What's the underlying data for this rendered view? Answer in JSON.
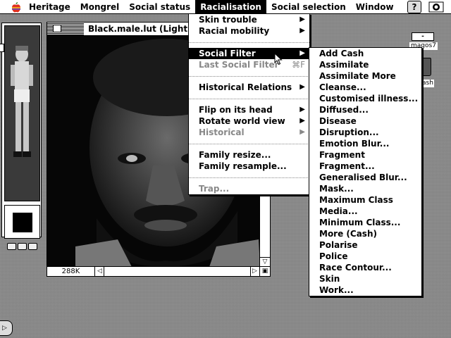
{
  "menubar": {
    "items": [
      "Heritage",
      "Mongrel",
      "Social status",
      "Racialisation",
      "Social selection",
      "Window"
    ],
    "active_index": 3,
    "help_label": "?"
  },
  "image_window": {
    "title": "Black.male.lut  (Lightr",
    "zoom_readout": "288K"
  },
  "desktop": {
    "disk_label": "-",
    "user_label": "magos7",
    "trash_label": "ash"
  },
  "racialisation_menu": {
    "items": [
      {
        "label": "Skin trouble",
        "submenu": true
      },
      {
        "label": "Racial mobility",
        "submenu": true
      },
      {
        "separator": true
      },
      {
        "label": "Social Filter",
        "submenu": true,
        "selected": true
      },
      {
        "label": "Last Social Filter",
        "shortcut": "⌘F",
        "disabled": true
      },
      {
        "separator": true
      },
      {
        "label": "Historical Relations",
        "submenu": true
      },
      {
        "separator": true
      },
      {
        "label": "Flip on its head",
        "submenu": true
      },
      {
        "label": "Rotate world view",
        "submenu": true
      },
      {
        "label": "Historical",
        "submenu": true,
        "disabled": true
      },
      {
        "separator": true
      },
      {
        "label": "Family resize..."
      },
      {
        "label": "Family resample..."
      },
      {
        "separator": true
      },
      {
        "label": "Trap...",
        "disabled": true
      }
    ]
  },
  "social_filter_submenu": {
    "items": [
      "Add Cash",
      "Assimilate",
      "Assimilate More",
      "Cleanse...",
      "Customised illness...",
      "Diffused...",
      "Disease",
      "Disruption...",
      "Emotion Blur...",
      "Fragment",
      "Fragment...",
      "Generalised Blur...",
      "Mask...",
      "Maximum Class",
      "Media...",
      "Minimum Class...",
      "More (Cash)",
      "Polarise",
      "Police",
      "Race Contour...",
      "Skin",
      "Work..."
    ]
  }
}
